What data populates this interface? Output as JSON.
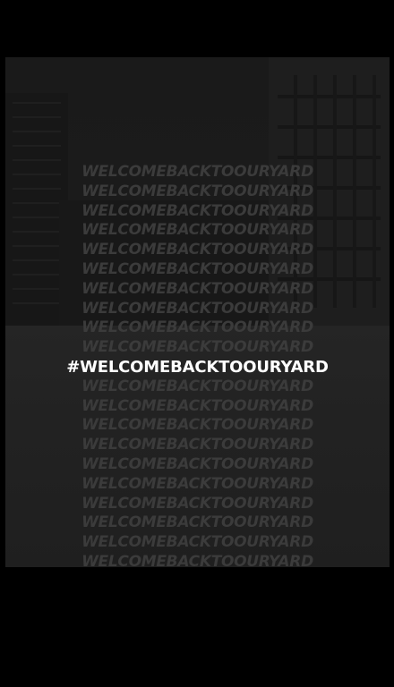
{
  "ghost_text": "WELCOMEBACKTOOURYARD",
  "hashtag": "#WELCOMEBACKTOOURYARD",
  "ghost_color": "#3b3b3b",
  "hashtag_color": "#ffffff",
  "background_color": "#000000"
}
